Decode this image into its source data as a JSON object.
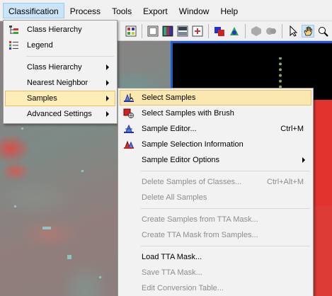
{
  "menubar": {
    "items": [
      "Classification",
      "Process",
      "Tools",
      "Export",
      "Window",
      "Help"
    ]
  },
  "classification_menu": {
    "items": [
      {
        "label": "Class Hierarchy",
        "icon": "class-hierarchy-icon"
      },
      {
        "label": "Legend",
        "icon": "legend-icon"
      },
      {
        "label": "Class Hierarchy",
        "submenu": true
      },
      {
        "label": "Nearest Neighbor",
        "submenu": true
      },
      {
        "label": "Samples",
        "submenu": true,
        "highlighted": true
      },
      {
        "label": "Advanced Settings",
        "submenu": true
      }
    ]
  },
  "samples_menu": {
    "items": [
      {
        "label": "Select Samples",
        "icon": "select-samples-icon",
        "highlighted": true
      },
      {
        "label": "Select Samples with Brush",
        "icon": "brush-icon"
      },
      {
        "label": "Sample Editor...",
        "icon": "sample-editor-icon",
        "shortcut": "Ctrl+M"
      },
      {
        "label": "Sample Selection Information",
        "icon": "sample-info-icon"
      },
      {
        "label": "Sample Editor Options",
        "submenu": true
      },
      {
        "label": "Delete Samples of Classes...",
        "shortcut": "Ctrl+Alt+M",
        "disabled": true
      },
      {
        "label": "Delete All Samples",
        "disabled": true
      },
      {
        "label": "Create Samples from TTA Mask...",
        "disabled": true
      },
      {
        "label": "Create TTA Mask from Samples...",
        "disabled": true
      },
      {
        "label": "Load TTA Mask..."
      },
      {
        "label": "Save TTA Mask...",
        "disabled": true
      },
      {
        "label": "Edit Conversion Table...",
        "disabled": true
      }
    ]
  },
  "colors": {
    "highlight": "#fbe7b0",
    "viewer_border": "#1a5bd8",
    "classified_red": "#e2342f"
  }
}
